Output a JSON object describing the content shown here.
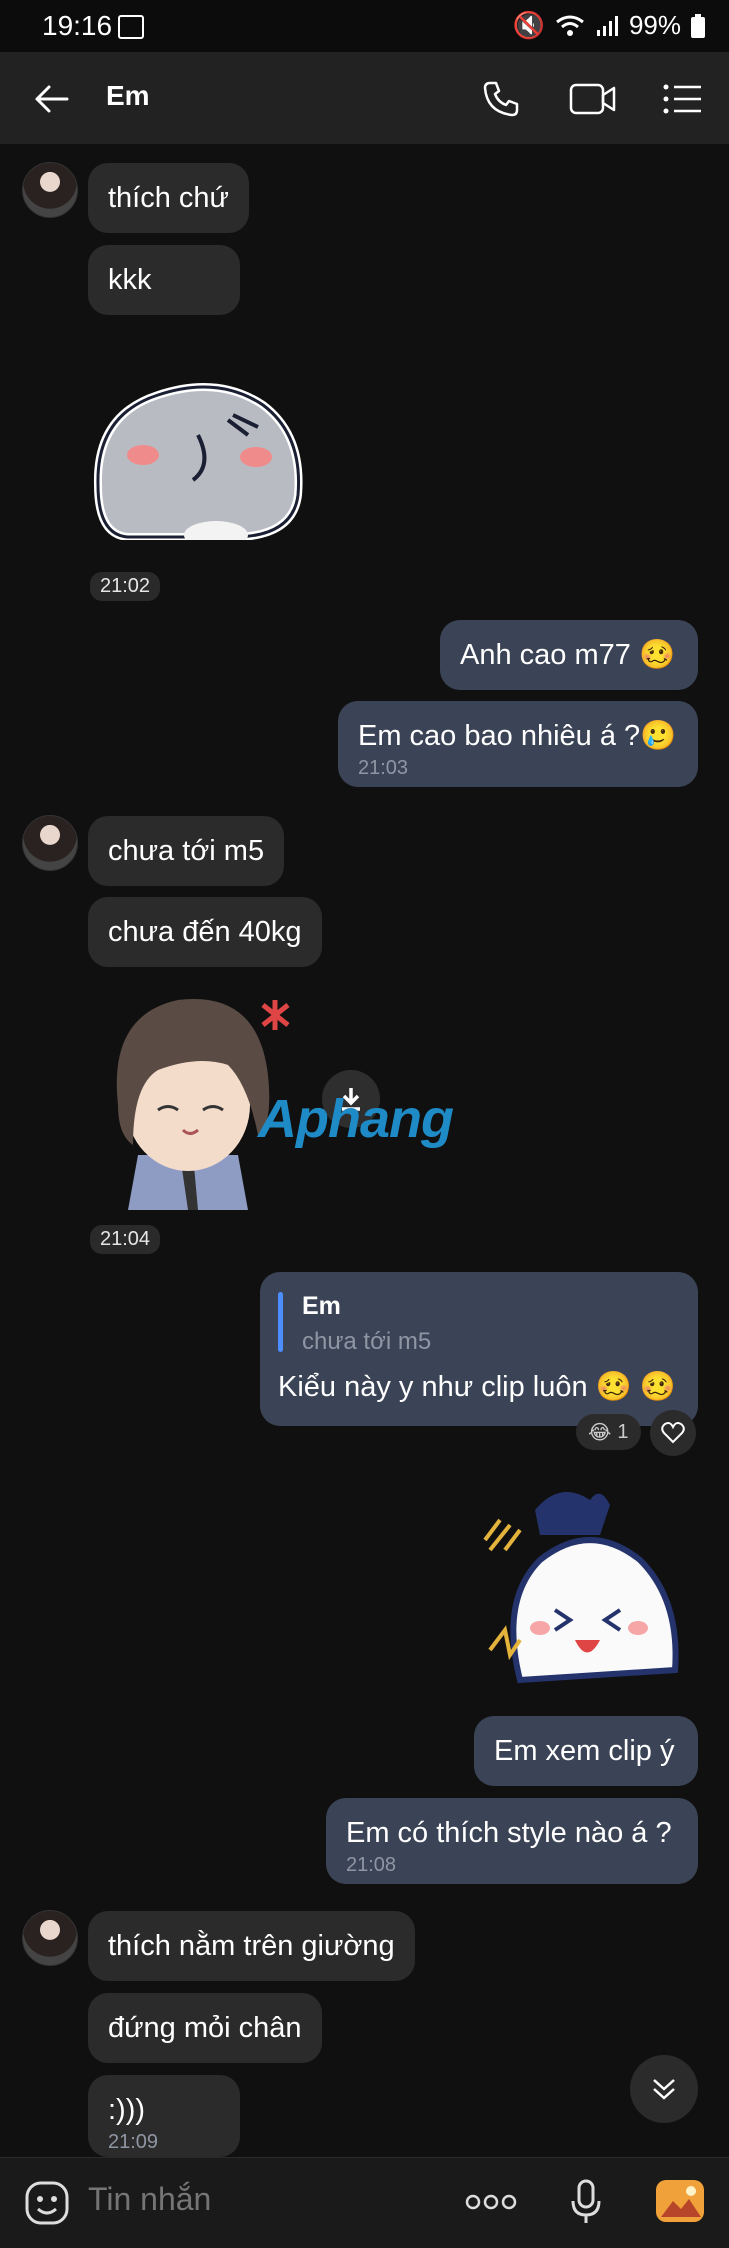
{
  "status": {
    "time": "19:16",
    "battery": "99%"
  },
  "header": {
    "title": "Em"
  },
  "messages": {
    "m1": "thích chứ",
    "m2": "kkk",
    "t1": "21:02",
    "m3": "Anh cao m77 🥴",
    "m4": "Em cao bao nhiêu á ?🥲",
    "t2": "21:03",
    "m5": "chưa tới m5",
    "m6": "chưa đến 40kg",
    "t3": "21:04",
    "reply_name": "Em",
    "reply_quote": "chưa tới m5",
    "m7": "Kiểu này y như clip luôn 🥴 🥴",
    "reaction_count": "1",
    "m8": "Em xem clip ý",
    "m9": "Em có thích style nào á ?",
    "t4": "21:08",
    "m10": "thích nằm trên giường",
    "m11": "đứng mỏi chân",
    "m12": ":)))",
    "t5": "21:09"
  },
  "watermark": "Aphang",
  "composer": {
    "placeholder": "Tin nhắn"
  },
  "icons": {
    "back": "arrow-left-icon",
    "call": "phone-icon",
    "video": "video-icon",
    "menu": "list-menu-icon",
    "emoji": "emoji-icon",
    "more": "more-dots-icon",
    "mic": "mic-icon",
    "gallery": "image-icon"
  }
}
